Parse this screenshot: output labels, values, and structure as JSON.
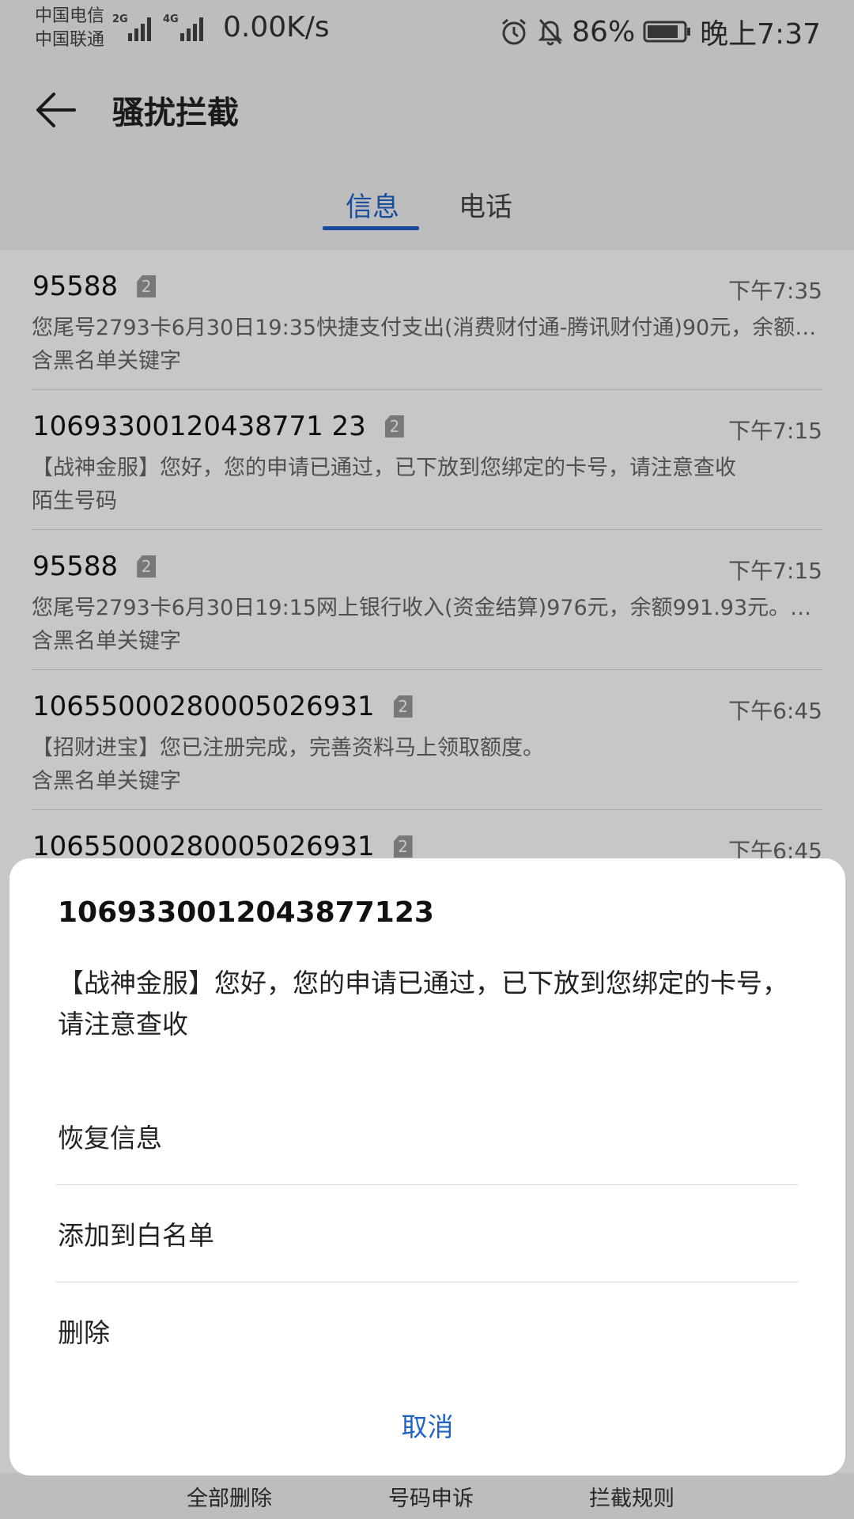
{
  "status_bar": {
    "carrier_1": "中国电信",
    "carrier_2": "中国联通",
    "net_type_1": "2G",
    "net_type_2": "4G",
    "net_speed": "0.00K/s",
    "battery": "86%",
    "time": "晚上7:37"
  },
  "header": {
    "title": "骚扰拦截"
  },
  "tabs": [
    {
      "label": "信息",
      "active": true
    },
    {
      "label": "电话",
      "active": false
    }
  ],
  "messages": [
    {
      "number": "95588",
      "sim": "2",
      "time": "下午7:35",
      "preview": "您尾号2793卡6月30日19:35快捷支付支出(消费财付通-腾讯财付通)90元，余额…",
      "tag": "含黑名单关键字"
    },
    {
      "number": "10693300120438771 23",
      "sim": "2",
      "time": "下午7:15",
      "preview": "【战神金服】您好，您的申请已通过，已下放到您绑定的卡号，请注意查收",
      "tag": "陌生号码"
    },
    {
      "number": "95588",
      "sim": "2",
      "time": "下午7:15",
      "preview": "您尾号2793卡6月30日19:15网上银行收入(资金结算)976元，余额991.93元。…",
      "tag": "含黑名单关键字"
    },
    {
      "number": "10655000280005026931",
      "sim": "2",
      "time": "下午6:45",
      "preview": "【招财进宝】您已注册完成，完善资料马上领取额度。",
      "tag": "含黑名单关键字"
    },
    {
      "number": "10655000280005026931",
      "sim": "2",
      "time": "下午6:45",
      "preview": "",
      "tag": ""
    }
  ],
  "bottom_bar": {
    "delete_all": "全部删除",
    "appeal": "号码申诉",
    "rules": "拦截规则"
  },
  "dialog": {
    "title": "1069330012043877123",
    "message": "【战神金服】您好，您的申请已通过，已下放到您绑定的卡号，请注意查收",
    "options": [
      "恢复信息",
      "添加到白名单",
      "删除"
    ],
    "cancel": "取消"
  },
  "colors": {
    "accent": "#1e63c8",
    "background": "#f2f2f2"
  }
}
